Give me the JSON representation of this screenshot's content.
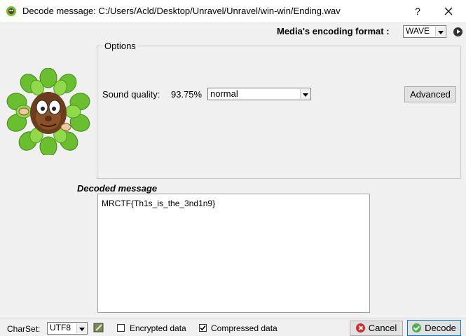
{
  "window": {
    "title": "Decode message: C:/Users/Acld/Desktop/Unravel/Unravel/win-win/Ending.wav",
    "help_label": "?"
  },
  "header": {
    "encoding_label": "Media's encoding format :",
    "encoding_value": "WAVE"
  },
  "options": {
    "legend": "Options",
    "sound_quality_label": "Sound quality:",
    "sound_quality_value": "93.75%",
    "quality_select_value": "normal",
    "advanced_label": "Advanced"
  },
  "decoded": {
    "label": "Decoded message",
    "text": "MRCTF{Th1s_is_the_3nd1n9}"
  },
  "footer": {
    "charset_label": "CharSet:",
    "charset_value": "UTF8",
    "encrypted_label": "Encrypted data",
    "encrypted_checked": false,
    "compressed_label": "Compressed data",
    "compressed_checked": true,
    "cancel_label": "Cancel",
    "decode_label": "Decode"
  },
  "colors": {
    "accent": "#0078d7",
    "leaf_green": "#6abf2e",
    "cancel_red": "#d42a2a"
  }
}
